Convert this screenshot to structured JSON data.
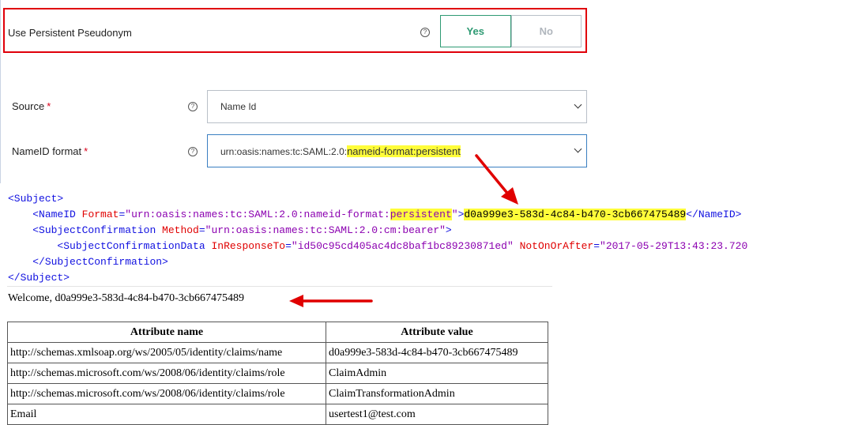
{
  "form": {
    "persistent": {
      "label": "Use Persistent Pseudonym",
      "options": [
        "Yes",
        "No"
      ],
      "selected": "Yes"
    },
    "source": {
      "label": "Source",
      "required_mark": "*",
      "value": "Name Id"
    },
    "nameid_format": {
      "label": "NameID format",
      "required_mark": "*",
      "value_prefix": "urn:oasis:names:tc:SAML:2.0:",
      "value_highlight": "nameid-format:persistent"
    },
    "help_glyph": "?"
  },
  "xml": {
    "subject_open": "<Subject>",
    "nameid_open": "<NameID ",
    "format_attr": "Format",
    "eq": "=",
    "format_val_prefix": "\"urn:oasis:names:tc:SAML:2.0:nameid-format:",
    "format_val_highlight": "persistent",
    "format_val_end": "\"",
    "gt": ">",
    "nameid_value": "d0a999e3-583d-4c84-b470-3cb667475489",
    "nameid_close": "</NameID>",
    "sc_open": "<SubjectConfirmation ",
    "method_attr": "Method",
    "method_val": "\"urn:oasis:names:tc:SAML:2.0:cm:bearer\"",
    "scd_open": "<SubjectConfirmationData ",
    "inresp_attr": "InResponseTo",
    "inresp_val": "\"id50c95cd405ac4dc8baf1bc89230871ed\"",
    "notafter_attr": "NotOnOrAfter",
    "notafter_val": "\"2017-05-29T13:43:23.720",
    "sc_close": "</SubjectConfirmation>",
    "subject_close": "</Subject>"
  },
  "welcome": "Welcome, d0a999e3-583d-4c84-b470-3cb667475489",
  "attributes": {
    "headers": [
      "Attribute name",
      "Attribute value"
    ],
    "rows": [
      [
        "http://schemas.xmlsoap.org/ws/2005/05/identity/claims/name",
        "d0a999e3-583d-4c84-b470-3cb667475489"
      ],
      [
        "http://schemas.microsoft.com/ws/2008/06/identity/claims/role",
        "ClaimAdmin"
      ],
      [
        "http://schemas.microsoft.com/ws/2008/06/identity/claims/role",
        "ClaimTransformationAdmin"
      ],
      [
        "Email",
        "usertest1@test.com"
      ]
    ]
  },
  "colors": {
    "highlight": "#fffd3a",
    "annotation_red": "#e00000",
    "yes_green": "#2e9a73"
  }
}
